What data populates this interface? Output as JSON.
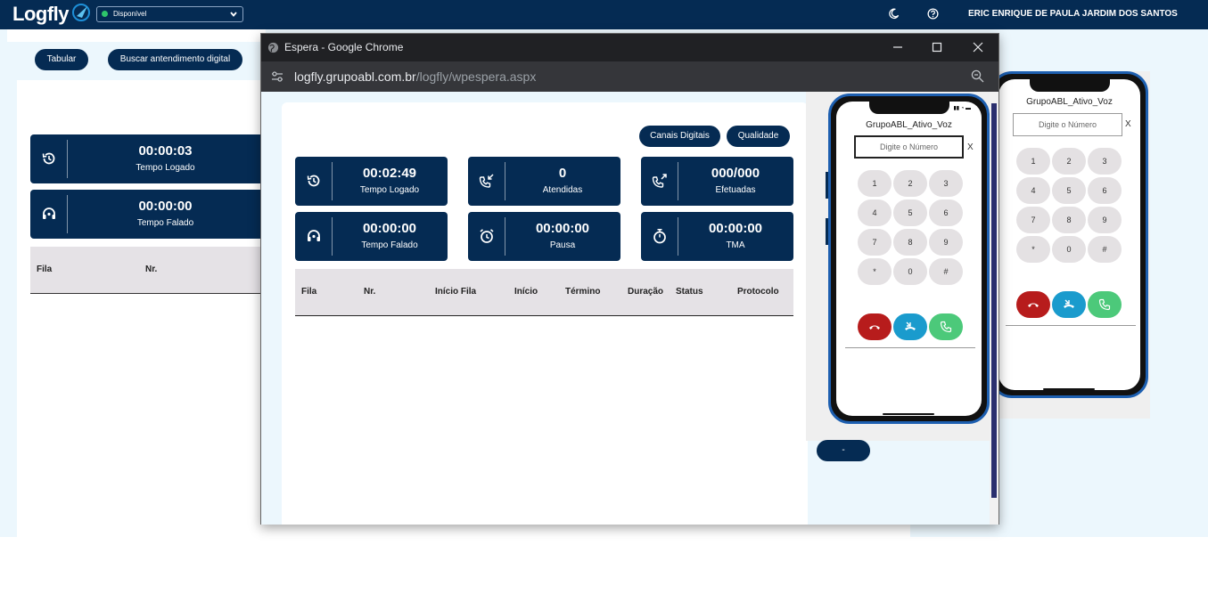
{
  "topbar": {
    "logo": "Logfly",
    "status": "Disponível",
    "user_name": "ERIC ENRIQUE DE PAULA JARDIM DOS SANTOS",
    "icons": [
      "moon-icon",
      "help-icon"
    ]
  },
  "background_page": {
    "buttons": {
      "tabular": "Tabular",
      "buscar": "Buscar antendimento digital"
    },
    "cards": [
      {
        "value": "00:00:03",
        "label": "Tempo Logado",
        "icon": "history-icon"
      },
      {
        "value": "00:00:00",
        "label": "Tempo Falado",
        "icon": "headset-icon"
      }
    ],
    "table_headers": [
      "Fila",
      "Nr."
    ]
  },
  "chrome_window": {
    "title": "Espera - Google Chrome",
    "url_host": "logfly.grupoabl.com.br",
    "url_path": "/logfly/wpespera.aspx"
  },
  "espera": {
    "buttons": {
      "canais": "Canais Digitais",
      "qualidade": "Qualidade"
    },
    "cards": [
      {
        "value": "00:02:49",
        "label": "Tempo Logado",
        "icon": "history-icon"
      },
      {
        "value": "0",
        "label": "Atendidas",
        "icon": "incoming-call-icon"
      },
      {
        "value": "000/000",
        "label": "Efetuadas",
        "icon": "outgoing-call-icon"
      },
      {
        "value": "00:00:00",
        "label": "Tempo Falado",
        "icon": "headset-icon"
      },
      {
        "value": "00:00:00",
        "label": "Pausa",
        "icon": "alarm-icon"
      },
      {
        "value": "00:00:00",
        "label": "TMA",
        "icon": "timer-icon"
      }
    ],
    "table_headers": [
      "Fila",
      "Nr.",
      "Início Fila",
      "Início",
      "Término",
      "Duração",
      "Status",
      "Protocolo"
    ],
    "dash_button": "-"
  },
  "phone": {
    "title": "GrupoABL_Ativo_Voz",
    "placeholder": "Digite o Número",
    "clear": "X",
    "keys": [
      "1",
      "2",
      "3",
      "4",
      "5",
      "6",
      "7",
      "8",
      "9",
      "*",
      "0",
      "#"
    ]
  },
  "colors": {
    "navy": "#052b53",
    "hangup": "#b71c1c",
    "transfer": "#1a9bcd",
    "call": "#4cc97a"
  }
}
